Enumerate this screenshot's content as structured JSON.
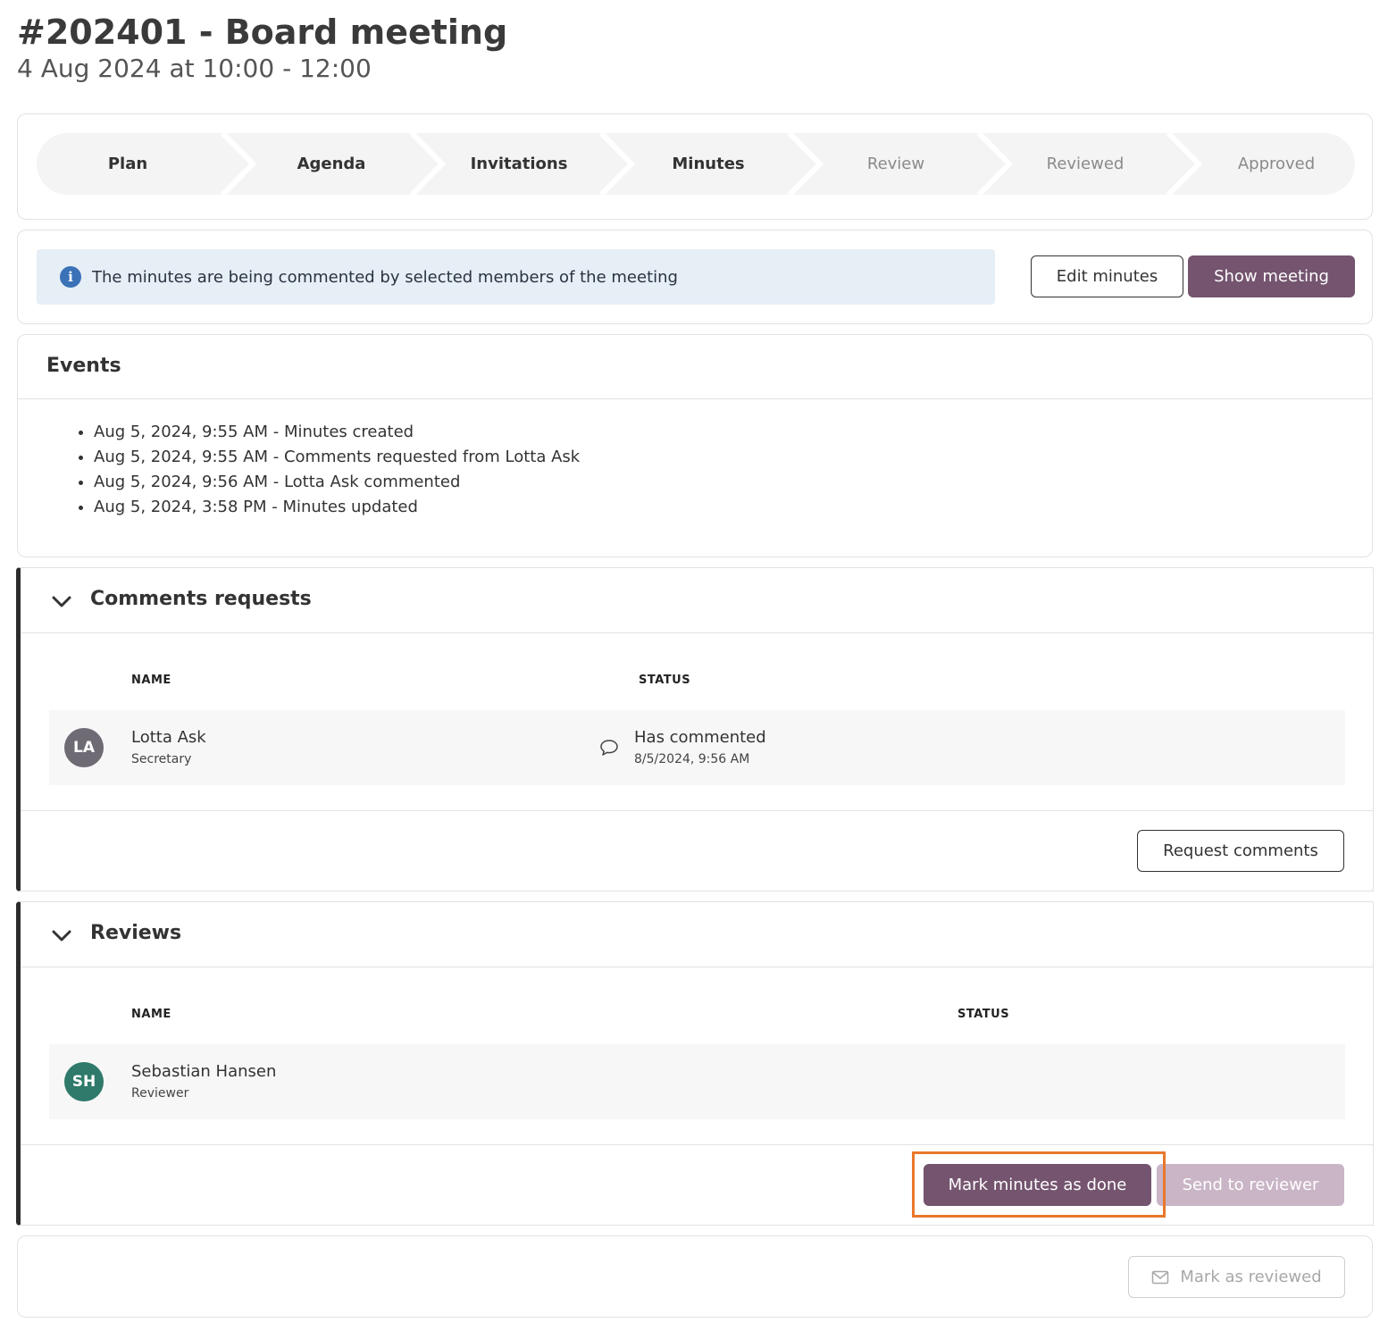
{
  "header": {
    "title": "#202401 - Board meeting",
    "subtitle": "4 Aug 2024 at 10:00 - 12:00"
  },
  "stepper": {
    "steps": [
      {
        "label": "Plan",
        "state": "done"
      },
      {
        "label": "Agenda",
        "state": "done"
      },
      {
        "label": "Invitations",
        "state": "done"
      },
      {
        "label": "Minutes",
        "state": "current"
      },
      {
        "label": "Review",
        "state": "future"
      },
      {
        "label": "Reviewed",
        "state": "future"
      },
      {
        "label": "Approved",
        "state": "future"
      }
    ]
  },
  "notice": {
    "icon": "info-icon",
    "text": "The minutes are being commented by selected members of the meeting",
    "edit_label": "Edit minutes",
    "show_label": "Show meeting"
  },
  "events": {
    "title": "Events",
    "items": [
      "Aug 5, 2024, 9:55 AM - Minutes created",
      "Aug 5, 2024, 9:55 AM - Comments requested from Lotta Ask",
      "Aug 5, 2024, 9:56 AM - Lotta Ask commented",
      "Aug 5, 2024, 3:58 PM - Minutes updated"
    ]
  },
  "comments": {
    "title": "Comments requests",
    "col_name": "NAME",
    "col_status": "STATUS",
    "rows": [
      {
        "initials": "LA",
        "avatar_color": "#6e6b75",
        "name": "Lotta Ask",
        "role": "Secretary",
        "status_icon": "comment-icon",
        "status": "Has commented",
        "status_time": "8/5/2024, 9:56 AM"
      }
    ],
    "request_label": "Request comments"
  },
  "reviews": {
    "title": "Reviews",
    "col_name": "NAME",
    "col_status": "STATUS",
    "rows": [
      {
        "initials": "SH",
        "avatar_color": "#2f7a6a",
        "name": "Sebastian Hansen",
        "role": "Reviewer"
      }
    ],
    "mark_done_label": "Mark minutes as done",
    "send_label": "Send to reviewer"
  },
  "footer": {
    "mark_reviewed_icon": "envelope-icon",
    "mark_reviewed_label": "Mark as reviewed"
  },
  "colors": {
    "primary": "#74546f",
    "primary_disabled": "#c9b5c6",
    "info": "#3b72b7",
    "highlight": "#e8782c"
  }
}
